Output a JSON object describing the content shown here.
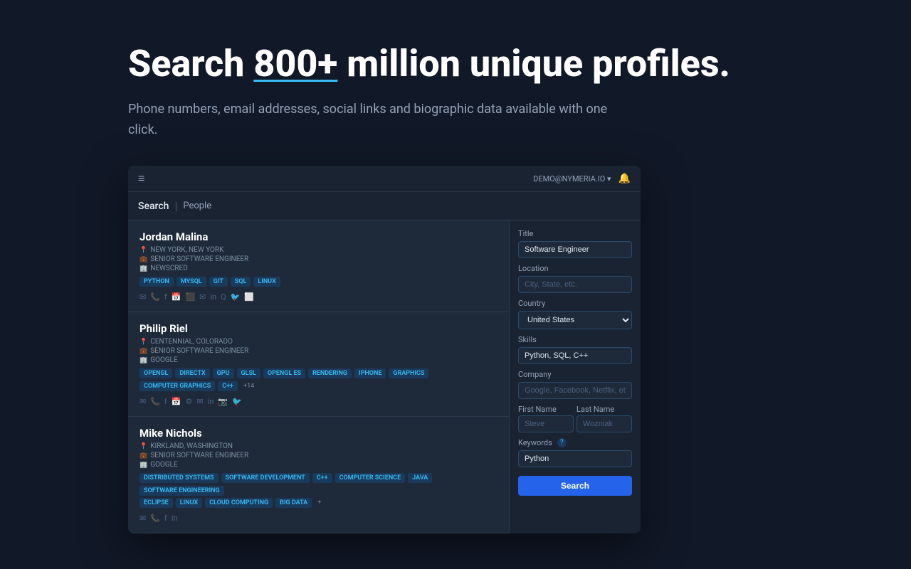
{
  "page": {
    "background": "#111827"
  },
  "headline": {
    "prefix": "Search ",
    "highlight": "800+",
    "suffix": " million unique profiles."
  },
  "subtitle": "Phone numbers, email addresses, social links and biographic data available with one click.",
  "app": {
    "topbar": {
      "demo_label": "DEMO@NYMERIA.IO ▾",
      "hamburger": "≡",
      "bell": "🔔"
    },
    "searchbar": {
      "search_label": "Search",
      "divider": "|",
      "category": "People"
    },
    "filters": {
      "title_label": "Title",
      "title_placeholder": "Software Engineer",
      "title_value": "Software Engineer",
      "location_label": "Location",
      "location_placeholder": "City, State, etc.",
      "country_label": "Country",
      "country_value": "United States",
      "skills_label": "Skills",
      "skills_value": "Python, SQL, C++",
      "company_label": "Company",
      "company_placeholder": "Google, Facebook, Netflix, etc...",
      "firstname_label": "First Name",
      "firstname_placeholder": "Steve",
      "lastname_label": "Last Name",
      "lastname_placeholder": "Wozniak",
      "keywords_label": "Keywords",
      "keywords_tooltip": "?",
      "keywords_value": "Python",
      "search_button": "Search"
    },
    "results": [
      {
        "name": "Jordan Malina",
        "location": "NEW YORK, NEW YORK",
        "title": "SENIOR SOFTWARE ENGINEER",
        "company": "NEWSCRED",
        "tags": [
          "PYTHON",
          "MYSQL",
          "GIT",
          "SQL",
          "LINUX"
        ],
        "tags_more": null,
        "icons": [
          "✉",
          "📞",
          "f",
          "📅",
          "⬜",
          "✉",
          "in",
          "Q",
          "🐦",
          "⬜"
        ]
      },
      {
        "name": "Philip Riel",
        "location": "CENTENNIAL, COLORADO",
        "title": "SENIOR SOFTWARE ENGINEER",
        "company": "GOOGLE",
        "tags": [
          "OPENGL",
          "DIRECTX",
          "GPU",
          "GLSL",
          "OPENGL ES",
          "RENDERING",
          "IPHONE",
          "GRAPHICS",
          "COMPUTER GRAPHICS",
          "C++"
        ],
        "tags_more": "+14",
        "icons": [
          "✉",
          "📞",
          "f",
          "📅",
          "⚙",
          "✉",
          "in",
          "📷",
          "🐦"
        ]
      },
      {
        "name": "Mike Nichols",
        "location": "KIRKLAND, WASHINGTON",
        "title": "SENIOR SOFTWARE ENGINEER",
        "company": "GOOGLE",
        "tags": [
          "DISTRIBUTED SYSTEMS",
          "SOFTWARE DEVELOPMENT",
          "C++",
          "COMPUTER SCIENCE",
          "JAVA",
          "SOFTWARE ENGINEERING"
        ],
        "tags_row2": [
          "ECLIPSE",
          "LINUX",
          "CLOUD COMPUTING",
          "BIG DATA"
        ],
        "tags_more": "+",
        "icons": [
          "✉",
          "📞",
          "f",
          "in"
        ]
      }
    ]
  }
}
